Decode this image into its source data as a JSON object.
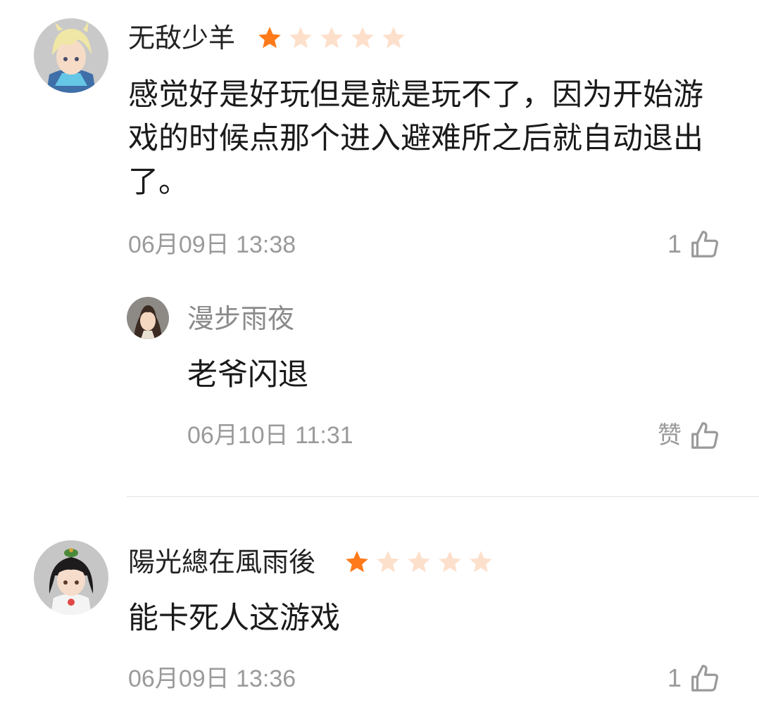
{
  "comments": [
    {
      "username": "无敌少羊",
      "rating": 1,
      "max_rating": 5,
      "text": "感觉好是好玩但是就是玩不了，因为开始游戏的时候点那个进入避难所之后就自动退出了。",
      "timestamp": "06月09日 13:38",
      "likes": "1",
      "avatar_icon": "anime-boy-avatar",
      "replies": [
        {
          "username": "漫步雨夜",
          "text": "老爷闪退",
          "timestamp": "06月10日 11:31",
          "likes": "赞",
          "avatar_icon": "anime-longhair-avatar"
        }
      ]
    },
    {
      "username": "陽光總在風雨後",
      "rating": 1,
      "max_rating": 5,
      "text": "能卡死人这游戏",
      "timestamp": "06月09日 13:36",
      "likes": "1",
      "avatar_icon": "anime-girl-avatar"
    }
  ],
  "colors": {
    "star_filled": "#ff7a1a",
    "star_empty": "#fde0cc",
    "timestamp": "#9a9a9a",
    "divider": "#eeeeee"
  }
}
